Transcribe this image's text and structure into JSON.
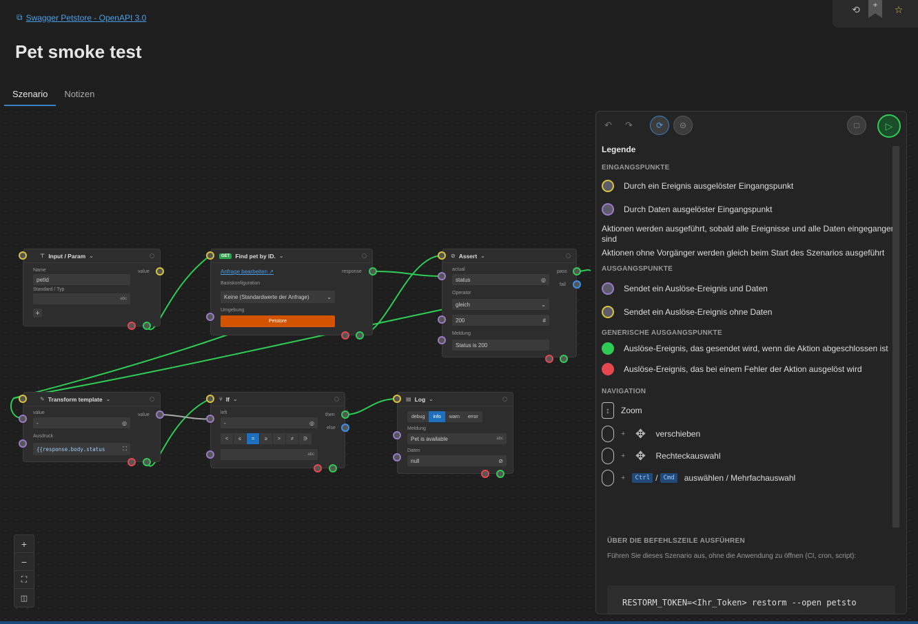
{
  "breadcrumb": {
    "label": "Swagger Petstore - OpenAPI 3.0"
  },
  "page": {
    "title": "Pet smoke test"
  },
  "tabs": [
    {
      "label": "Szenario"
    },
    {
      "label": "Notizen"
    }
  ],
  "nodes": {
    "input_param": {
      "title": "Input / Param",
      "name_label": "Name",
      "name_value": "petId",
      "type_label": "Standard / Typ",
      "type_suffix": "abc",
      "out_label": "value",
      "add_symbol": "+"
    },
    "find_pet": {
      "method": "GET",
      "title": "Find pet by ID.",
      "edit_link": "Anfrage bearbeiten",
      "base_label": "Basiskonfiguration",
      "base_value": "Keine (Standardwerte der Anfrage)",
      "env_label": "Umgebung",
      "env_value": "Petstore",
      "out_label": "response"
    },
    "assert": {
      "title": "Assert",
      "actual_label": "actual",
      "actual_value": "status",
      "operator_label": "Operator",
      "operator_value": "gleich",
      "expected_value": "200",
      "message_label": "Meldung",
      "message_value": "Status is 200",
      "pass_label": "pass",
      "fail_label": "fail"
    },
    "transform": {
      "title": "Transform template",
      "value_label": "value",
      "value_value": "-",
      "expr_label": "Ausdruck",
      "expr_value": "{{response.body.status",
      "out_label": "value"
    },
    "if_node": {
      "title": "If",
      "left_label": "left",
      "left_value": "-",
      "ops": [
        "<",
        "≤",
        "=",
        "≥",
        ">",
        "≠",
        "∋"
      ],
      "right_suffix": "abc",
      "then_label": "then",
      "else_label": "else"
    },
    "log": {
      "title": "Log",
      "levels": [
        "debug",
        "info",
        "warn",
        "error"
      ],
      "message_label": "Meldung",
      "message_value": "Pet is available",
      "message_suffix": "abc",
      "data_label": "Daten",
      "data_value": "null"
    }
  },
  "panel": {
    "legend_title": "Legende",
    "entry_section": "EINGANGSPUNKTE",
    "entry_event": "Durch ein Ereignis ausgelöster Eingangspunkt",
    "entry_data": "Durch Daten ausgelöster Eingangspunkt",
    "note1": "Aktionen werden ausgeführt, sobald alle Ereignisse und alle Daten eingegangen sind",
    "note2": "Aktionen ohne Vorgänger werden gleich beim Start des Szenarios ausgeführt",
    "exit_section": "AUSGANGSPUNKTE",
    "exit_event_data": "Sendet ein Auslöse-Ereignis und Daten",
    "exit_event": "Sendet ein Auslöse-Ereignis ohne Daten",
    "generic_section": "GENERISCHE AUSGANGSPUNKTE",
    "generic_done": "Auslöse-Ereignis, das gesendet wird, wenn die Aktion abgeschlossen ist",
    "generic_error": "Auslöse-Ereignis, das bei einem Fehler der Aktion ausgelöst wird",
    "nav_section": "NAVIGATION",
    "nav_zoom": "Zoom",
    "nav_move": "verschieben",
    "nav_rect": "Rechteckauswahl",
    "nav_ctrl": "Ctrl",
    "nav_slash": "/",
    "nav_cmd": "Cmd",
    "nav_select": "auswählen / Mehrfachauswahl",
    "nav_plus": "+",
    "cli_title": "ÜBER DIE BEFEHLSZEILE AUSFÜHREN",
    "cli_desc": "Führen Sie dieses Szenario aus, ohne die Anwendung zu öffnen (CI, cron, script):",
    "cli_cmd": "RESTORM_TOKEN=<Ihr_Token> restorm --open petsto"
  },
  "colors": {
    "accent": "#3b82c4",
    "event_port": "#d8c43a",
    "data_port": "#9a7ac9",
    "success_port": "#2ecc55",
    "error_port": "#e5484d",
    "else_port": "#3b8ff0",
    "env_button": "#d35400"
  }
}
